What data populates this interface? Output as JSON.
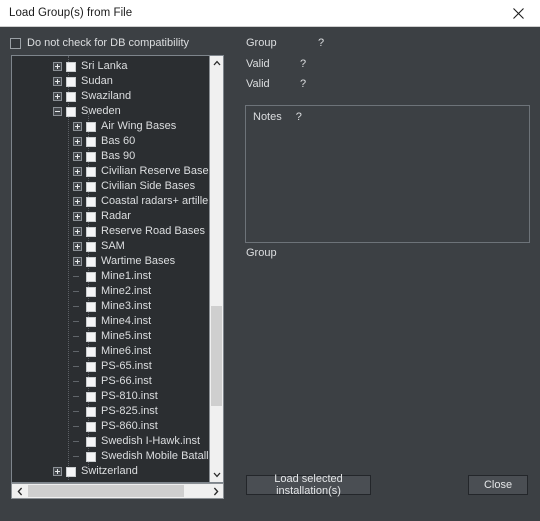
{
  "window": {
    "title": "Load Group(s) from File",
    "close_icon": "close-icon"
  },
  "options": {
    "db_compat_label": "Do not check for DB compatibility",
    "db_compat_checked": false
  },
  "tree": {
    "items": [
      {
        "label": "Sri Lanka",
        "depth": 0,
        "state": "collapsed"
      },
      {
        "label": "Sudan",
        "depth": 0,
        "state": "collapsed"
      },
      {
        "label": "Swaziland",
        "depth": 0,
        "state": "collapsed"
      },
      {
        "label": "Sweden",
        "depth": 0,
        "state": "expanded"
      },
      {
        "label": "Air Wing Bases",
        "depth": 1,
        "state": "collapsed"
      },
      {
        "label": "Bas 60",
        "depth": 1,
        "state": "collapsed"
      },
      {
        "label": "Bas 90",
        "depth": 1,
        "state": "collapsed"
      },
      {
        "label": "Civilian Reserve Bases",
        "depth": 1,
        "state": "collapsed"
      },
      {
        "label": "Civilian Side Bases",
        "depth": 1,
        "state": "collapsed"
      },
      {
        "label": "Coastal radars+ artillery",
        "depth": 1,
        "state": "collapsed"
      },
      {
        "label": "Radar",
        "depth": 1,
        "state": "collapsed"
      },
      {
        "label": "Reserve Road Bases",
        "depth": 1,
        "state": "collapsed"
      },
      {
        "label": "SAM",
        "depth": 1,
        "state": "collapsed"
      },
      {
        "label": "Wartime Bases",
        "depth": 1,
        "state": "collapsed"
      },
      {
        "label": "Mine1.inst",
        "depth": 1,
        "state": "leaf"
      },
      {
        "label": "Mine2.inst",
        "depth": 1,
        "state": "leaf"
      },
      {
        "label": "Mine3.inst",
        "depth": 1,
        "state": "leaf"
      },
      {
        "label": "Mine4.inst",
        "depth": 1,
        "state": "leaf"
      },
      {
        "label": "Mine5.inst",
        "depth": 1,
        "state": "leaf"
      },
      {
        "label": "Mine6.inst",
        "depth": 1,
        "state": "leaf"
      },
      {
        "label": "PS-65.inst",
        "depth": 1,
        "state": "leaf"
      },
      {
        "label": "PS-66.inst",
        "depth": 1,
        "state": "leaf"
      },
      {
        "label": "PS-810.inst",
        "depth": 1,
        "state": "leaf"
      },
      {
        "label": "PS-825.inst",
        "depth": 1,
        "state": "leaf"
      },
      {
        "label": "PS-860.inst",
        "depth": 1,
        "state": "leaf"
      },
      {
        "label": "Swedish I-Hawk.inst",
        "depth": 1,
        "state": "leaf"
      },
      {
        "label": "Swedish Mobile Batallions.ins",
        "depth": 1,
        "state": "leaf"
      },
      {
        "label": "Switzerland",
        "depth": 0,
        "state": "collapsed"
      }
    ],
    "scroll": {
      "up_arrow": "chevron-up-icon",
      "down_arrow": "chevron-down-icon",
      "left_arrow": "chevron-left-icon",
      "right_arrow": "chevron-right-icon"
    }
  },
  "details": {
    "group_label": "Group",
    "group_value": "?",
    "valid1_label": "Valid",
    "valid1_value": "?",
    "valid2_label": "Valid",
    "valid2_value": "?",
    "notes_label": "Notes",
    "notes_value": "?",
    "group_bottom_label": "Group"
  },
  "actions": {
    "load_label": "Load selected installation(s)",
    "close_label": "Close"
  },
  "colors": {
    "window_bg": "#3c4044",
    "titlebar_bg": "#ffffff",
    "tree_bg": "#2b2e31",
    "text": "#dcdee0",
    "scrollbar_track": "#f0f0f0",
    "scrollbar_thumb": "#cfcfcf"
  }
}
